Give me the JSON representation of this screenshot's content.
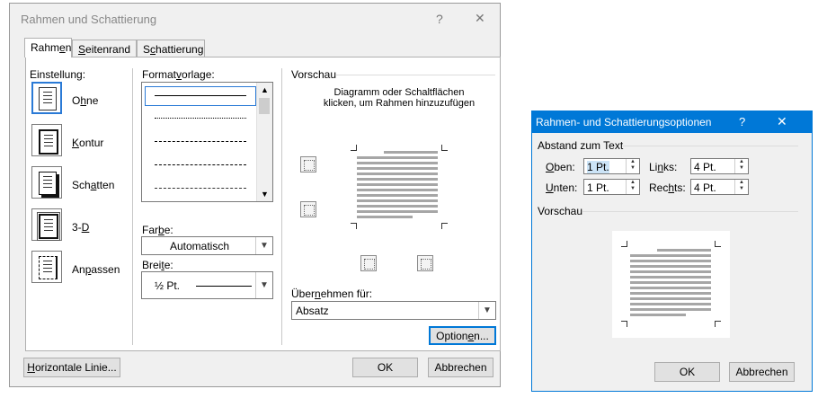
{
  "main_dialog": {
    "title": "Rahmen und Schattierung",
    "help_glyph": "?",
    "close_glyph": "✕",
    "tabs": [
      {
        "label_pre": "Rahm",
        "label_u": "e",
        "label_post": "n"
      },
      {
        "label_pre": "",
        "label_u": "S",
        "label_post": "eitenrand"
      },
      {
        "label_pre": "S",
        "label_u": "c",
        "label_post": "hattierung"
      }
    ],
    "einstellung_label": "Einstellung:",
    "settings": [
      {
        "pre": "O",
        "u": "h",
        "post": "ne"
      },
      {
        "pre": "",
        "u": "K",
        "post": "ontur"
      },
      {
        "pre": "Sch",
        "u": "a",
        "post": "tten"
      },
      {
        "pre": "3-",
        "u": "D",
        "post": ""
      },
      {
        "pre": "An",
        "u": "p",
        "post": "assen"
      }
    ],
    "formatvorlage_label": {
      "pre": "Format",
      "u": "v",
      "post": "orlage:"
    },
    "farbe_label": {
      "pre": "Far",
      "u": "b",
      "post": "e:"
    },
    "farbe_value": "Automatisch",
    "breite_label": {
      "pre": "Brei",
      "u": "t",
      "post": "e:"
    },
    "breite_value": "½ Pt.",
    "vorschau_label": "Vorschau",
    "vorschau_hint": "Diagramm oder Schaltflächen klicken, um Rahmen hinzuzufügen",
    "uebernehmen_label": {
      "pre": "Über",
      "u": "n",
      "post": "ehmen für:"
    },
    "uebernehmen_value": "Absatz",
    "optionen_button": {
      "pre": "Option",
      "u": "e",
      "post": "n..."
    },
    "horizontale_button": {
      "pre": "",
      "u": "H",
      "post": "orizontale Linie..."
    },
    "ok_button": "OK",
    "cancel_button": "Abbrechen"
  },
  "options_dialog": {
    "title": "Rahmen- und Schattierungsoptionen",
    "help_glyph": "?",
    "close_glyph": "✕",
    "abstand_label": "Abstand zum Text",
    "oben": {
      "pre": "",
      "u": "O",
      "post": "ben:",
      "value": "1 Pt."
    },
    "links": {
      "pre": "Li",
      "u": "n",
      "post": "ks:",
      "value": "4 Pt."
    },
    "unten": {
      "pre": "",
      "u": "U",
      "post": "nten:",
      "value": "1 Pt."
    },
    "rechts": {
      "pre": "Rec",
      "u": "h",
      "post": "ts:",
      "value": "4 Pt."
    },
    "vorschau_label": "Vorschau",
    "ok_button": "OK",
    "cancel_button": "Abbrechen"
  },
  "colors": {
    "accent": "#0078d7",
    "selection": "#2a7ad6",
    "preview_lines": "#a6a6a6"
  }
}
